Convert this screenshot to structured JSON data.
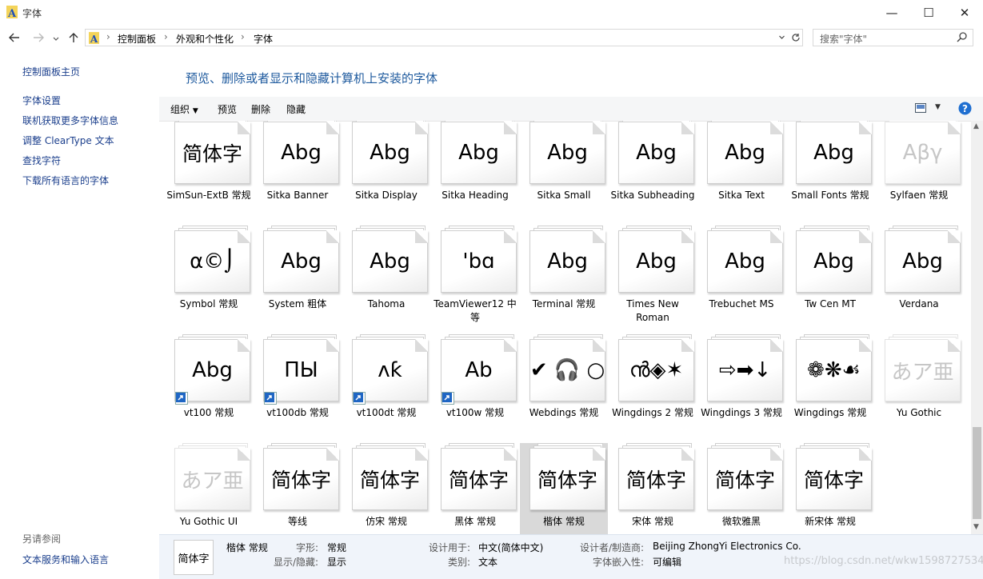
{
  "window": {
    "title": "字体"
  },
  "address": {
    "segments": [
      "控制面板",
      "外观和个性化",
      "字体"
    ]
  },
  "search": {
    "placeholder": "搜索\"字体\""
  },
  "left_panel": {
    "links": [
      "控制面板主页",
      "字体设置",
      "联机获取更多字体信息",
      "调整 ClearType 文本",
      "查找字符",
      "下载所有语言的字体"
    ],
    "see_also": "另请参阅",
    "bottom_link": "文本服务和输入语言"
  },
  "heading": "预览、删除或者显示和隐藏计算机上安装的字体",
  "toolbar": {
    "organize": "组织",
    "preview": "预览",
    "delete": "删除",
    "hide": "隐藏"
  },
  "fonts": [
    {
      "label": "SimSun-ExtB 常规",
      "sample": "简体字"
    },
    {
      "label": "Sitka Banner",
      "sample": "Abg"
    },
    {
      "label": "Sitka Display",
      "sample": "Abg"
    },
    {
      "label": "Sitka Heading",
      "sample": "Abg"
    },
    {
      "label": "Sitka Small",
      "sample": "Abg"
    },
    {
      "label": "Sitka Subheading",
      "sample": "Abg"
    },
    {
      "label": "Sitka Text",
      "sample": "Abg"
    },
    {
      "label": "Small Fonts 常规",
      "sample": "Abg"
    },
    {
      "label": "Sylfaen 常规",
      "sample": "Aβγ"
    },
    {
      "label": "Symbol 常规",
      "sample": "α©⌡"
    },
    {
      "label": "System 粗体",
      "sample": "Abg"
    },
    {
      "label": "Tahoma",
      "sample": "Abg"
    },
    {
      "label": "TeamViewer12 中等",
      "sample": "ꞌbɑ"
    },
    {
      "label": "Terminal 常规",
      "sample": "Abg"
    },
    {
      "label": "Times New Roman",
      "sample": "Abg"
    },
    {
      "label": "Trebuchet MS",
      "sample": "Abg"
    },
    {
      "label": "Tw Cen MT",
      "sample": "Abg"
    },
    {
      "label": "Verdana",
      "sample": "Abg"
    },
    {
      "label": "vt100 常规",
      "sample": "Abg"
    },
    {
      "label": "vt100db 常规",
      "sample": "ΠЫ"
    },
    {
      "label": "vt100dt 常规",
      "sample": "ᴧƙ"
    },
    {
      "label": "vt100w 常规",
      "sample": "Ab"
    },
    {
      "label": "Webdings 常规",
      "sample": "✔ 🎧 ○"
    },
    {
      "label": "Wingdings 2 常规",
      "sample": "ൻ◈✶"
    },
    {
      "label": "Wingdings 3 常规",
      "sample": "⇨➡↓"
    },
    {
      "label": "Wingdings 常规",
      "sample": "❁❋☙"
    },
    {
      "label": "Yu Gothic",
      "sample": "あア亜"
    },
    {
      "label": "Yu Gothic UI",
      "sample": "あア亜"
    },
    {
      "label": "等线",
      "sample": "简体字"
    },
    {
      "label": "仿宋 常规",
      "sample": "简体字"
    },
    {
      "label": "黑体 常规",
      "sample": "简体字"
    },
    {
      "label": "楷体 常规",
      "sample": "简体字"
    },
    {
      "label": "宋体 常规",
      "sample": "简体字"
    },
    {
      "label": "微软雅黑",
      "sample": "简体字"
    },
    {
      "label": "新宋体 常规",
      "sample": "简体字"
    }
  ],
  "details": {
    "sample": "简体字",
    "name": "楷体 常规",
    "style_key": "字形:",
    "style_val": "常规",
    "show_key": "显示/隐藏:",
    "show_val": "显示",
    "design_key": "设计用于:",
    "design_val": "中文(简体中文)",
    "cat_key": "类别:",
    "cat_val": "文本",
    "maker_key": "设计者/制造商:",
    "maker_val": "Beijing ZhongYi Electronics Co.",
    "embed_key": "字体嵌入性:",
    "embed_val": "可编辑"
  },
  "watermark": "https://blog.csdn.net/wkw1598727534"
}
